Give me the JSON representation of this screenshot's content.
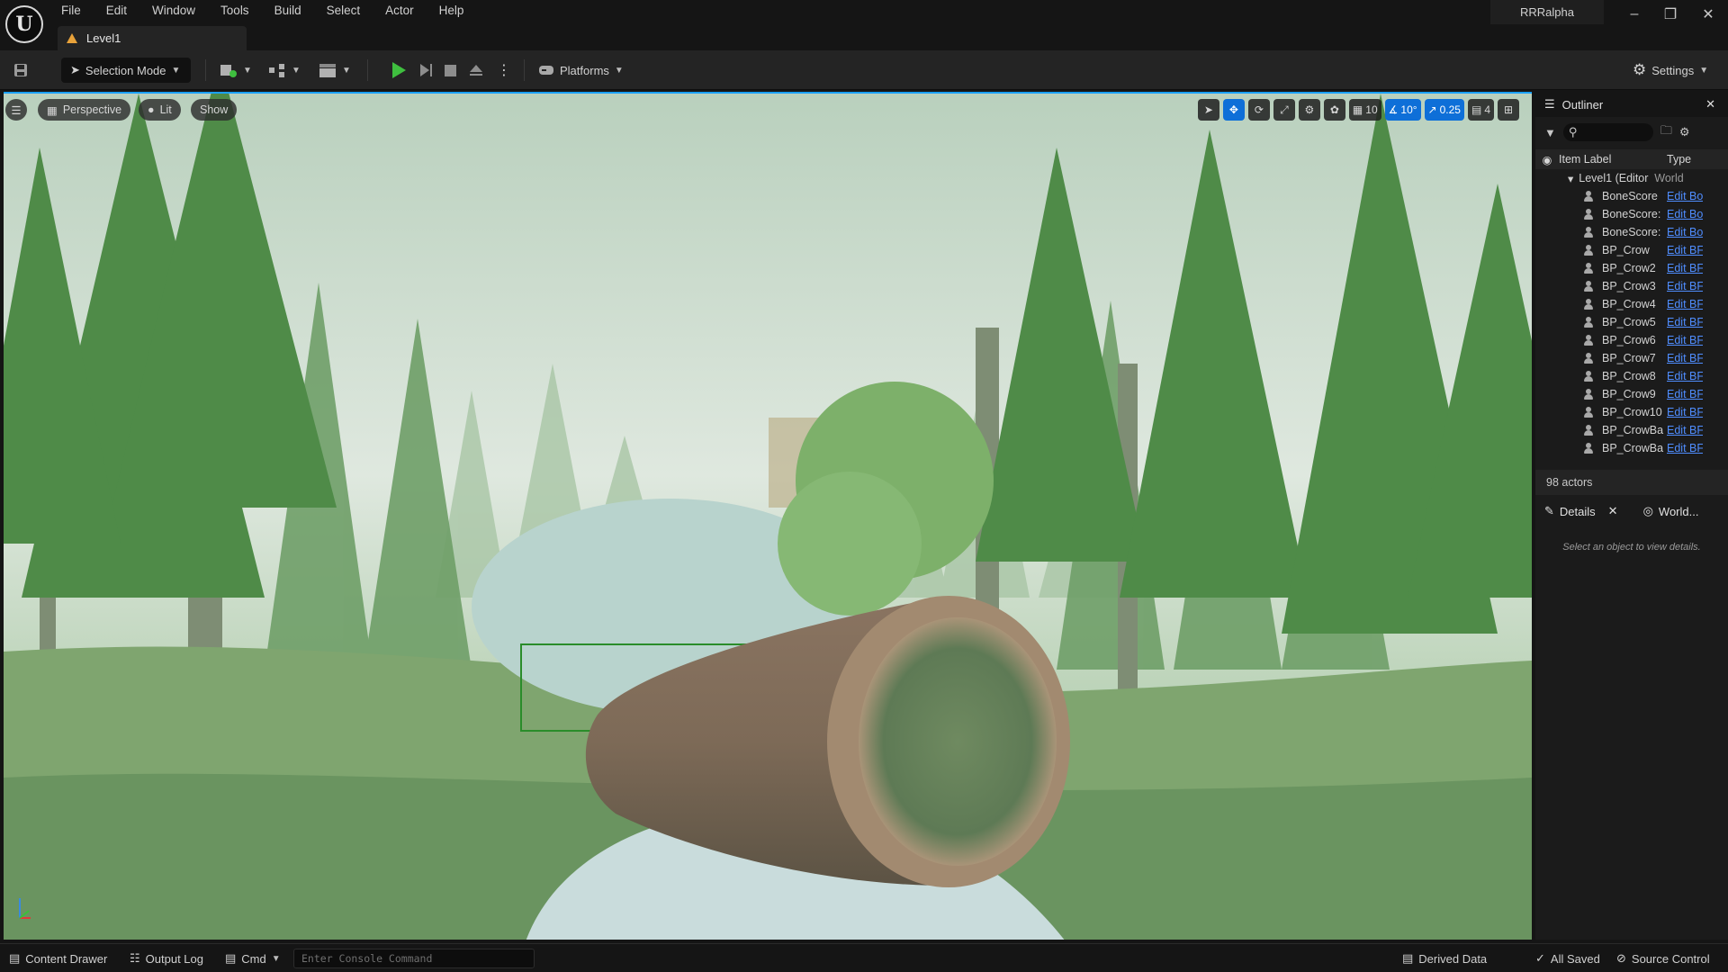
{
  "menu": [
    "File",
    "Edit",
    "Window",
    "Tools",
    "Build",
    "Select",
    "Actor",
    "Help"
  ],
  "level_tab": "Level1",
  "project": "RRRalpha",
  "toolbar": {
    "selection_mode": "Selection Mode",
    "platforms": "Platforms",
    "settings": "Settings"
  },
  "viewport": {
    "perspective": "Perspective",
    "lit": "Lit",
    "show": "Show",
    "grid_snap": "10",
    "rotation_snap": "10°",
    "scale_snap": "0.25",
    "camera_speed": "4"
  },
  "outliner": {
    "title": "Outliner",
    "col_label": "Item Label",
    "col_type": "Type",
    "root": {
      "label": "Level1 (Editor",
      "type": "World"
    },
    "rows": [
      {
        "label": "BoneScore",
        "type": "Edit Bo"
      },
      {
        "label": "BoneScore:",
        "type": "Edit Bo"
      },
      {
        "label": "BoneScore:",
        "type": "Edit Bo"
      },
      {
        "label": "BP_Crow",
        "type": "Edit BF"
      },
      {
        "label": "BP_Crow2",
        "type": "Edit BF"
      },
      {
        "label": "BP_Crow3",
        "type": "Edit BF"
      },
      {
        "label": "BP_Crow4",
        "type": "Edit BF"
      },
      {
        "label": "BP_Crow5",
        "type": "Edit BF"
      },
      {
        "label": "BP_Crow6",
        "type": "Edit BF"
      },
      {
        "label": "BP_Crow7",
        "type": "Edit BF"
      },
      {
        "label": "BP_Crow8",
        "type": "Edit BF"
      },
      {
        "label": "BP_Crow9",
        "type": "Edit BF"
      },
      {
        "label": "BP_Crow10",
        "type": "Edit BF"
      },
      {
        "label": "BP_CrowBa",
        "type": "Edit BF"
      },
      {
        "label": "BP_CrowBa",
        "type": "Edit BF"
      }
    ],
    "actor_count": "98 actors"
  },
  "details": {
    "tab": "Details",
    "world_tab": "World...",
    "empty_msg": "Select an object to view details."
  },
  "statusbar": {
    "content_drawer": "Content Drawer",
    "output_log": "Output Log",
    "cmd": "Cmd",
    "console_placeholder": "Enter Console Command",
    "derived_data": "Derived Data",
    "all_saved": "All Saved",
    "source_control": "Source Control"
  }
}
